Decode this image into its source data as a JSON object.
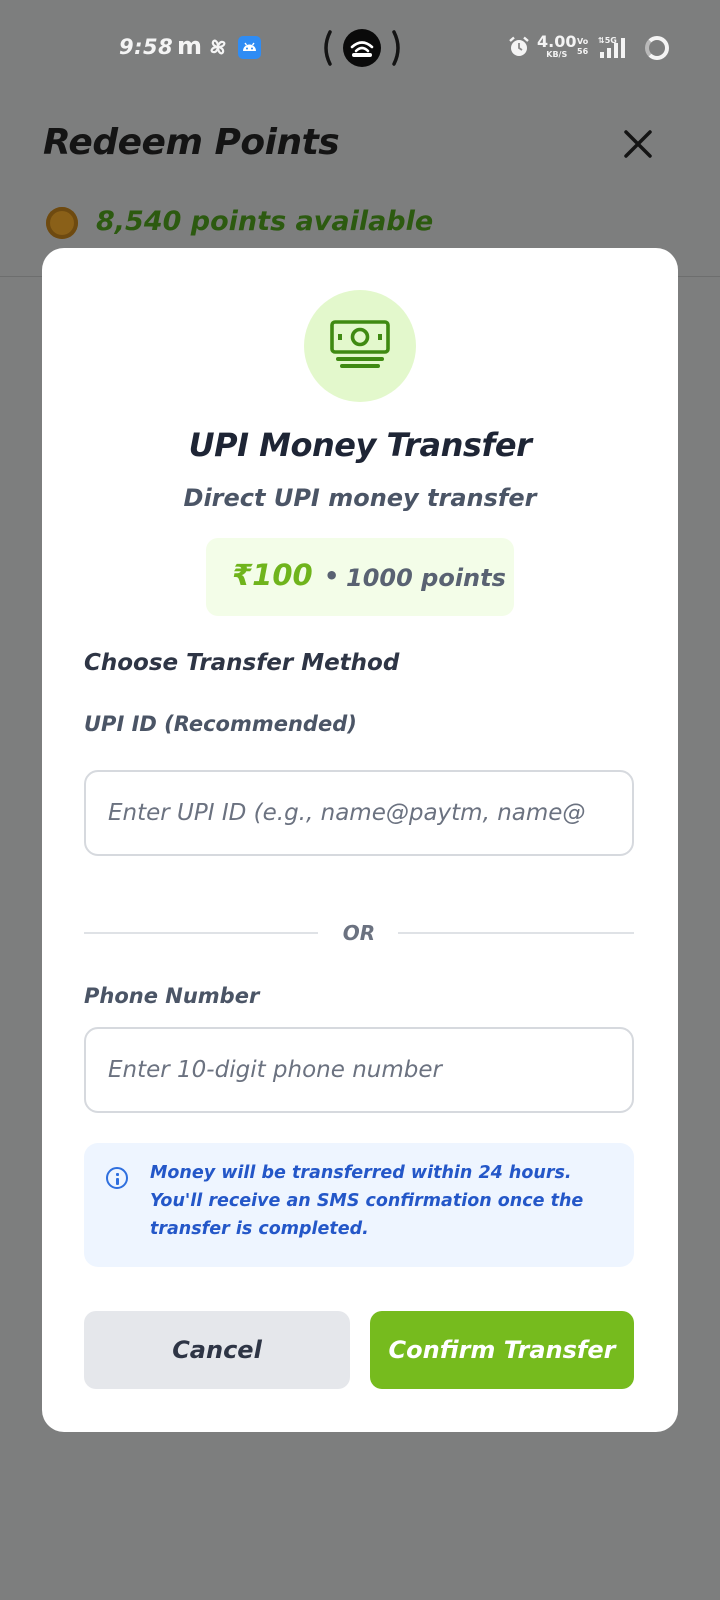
{
  "status_bar": {
    "time": "9:58",
    "app_letter": "m",
    "net_speed": "4.00",
    "net_speed_unit": "KB/S",
    "volte_top": "Vo",
    "volte_bottom": "56",
    "network": "5G"
  },
  "background_page": {
    "title": "Redeem Points",
    "points_available": "8,540 points available"
  },
  "modal": {
    "icon": "money-bill-icon",
    "title": "UPI Money Transfer",
    "subtitle": "Direct UPI money transfer",
    "amount": "₹100",
    "separator": "•",
    "points_cost": "1000 points",
    "section_label": "Choose Transfer Method",
    "upi_label": "UPI ID (Recommended)",
    "upi_placeholder": "Enter UPI ID (e.g., name@paytm, name@",
    "upi_value": "",
    "or_text": "OR",
    "phone_label": "Phone Number",
    "phone_placeholder": "Enter 10-digit phone number",
    "phone_value": "",
    "info_text": " Money will be transferred within 24 hours.\nYou'll receive an SMS confirmation once the\ntransfer is completed.",
    "cancel_label": "Cancel",
    "confirm_label": "Confirm Transfer"
  },
  "colors": {
    "accent_green": "#76bb1e",
    "overlay": "#7d7e7e",
    "info_blue": "#2457c8"
  }
}
